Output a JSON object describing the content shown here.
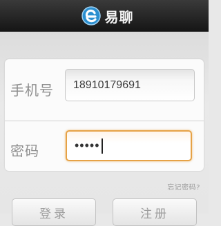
{
  "header": {
    "brand_name": "易聊",
    "logo_icon": "e-logo-icon",
    "accent": "#1f86c7"
  },
  "form": {
    "phone_label": "手机号",
    "phone_value": "18910179691",
    "password_label": "密码",
    "password_mask": "•••••",
    "focus_color": "#e6a246"
  },
  "links": {
    "forgot_password": "忘记密码?"
  },
  "buttons": {
    "login": "登录",
    "register": "注册"
  }
}
